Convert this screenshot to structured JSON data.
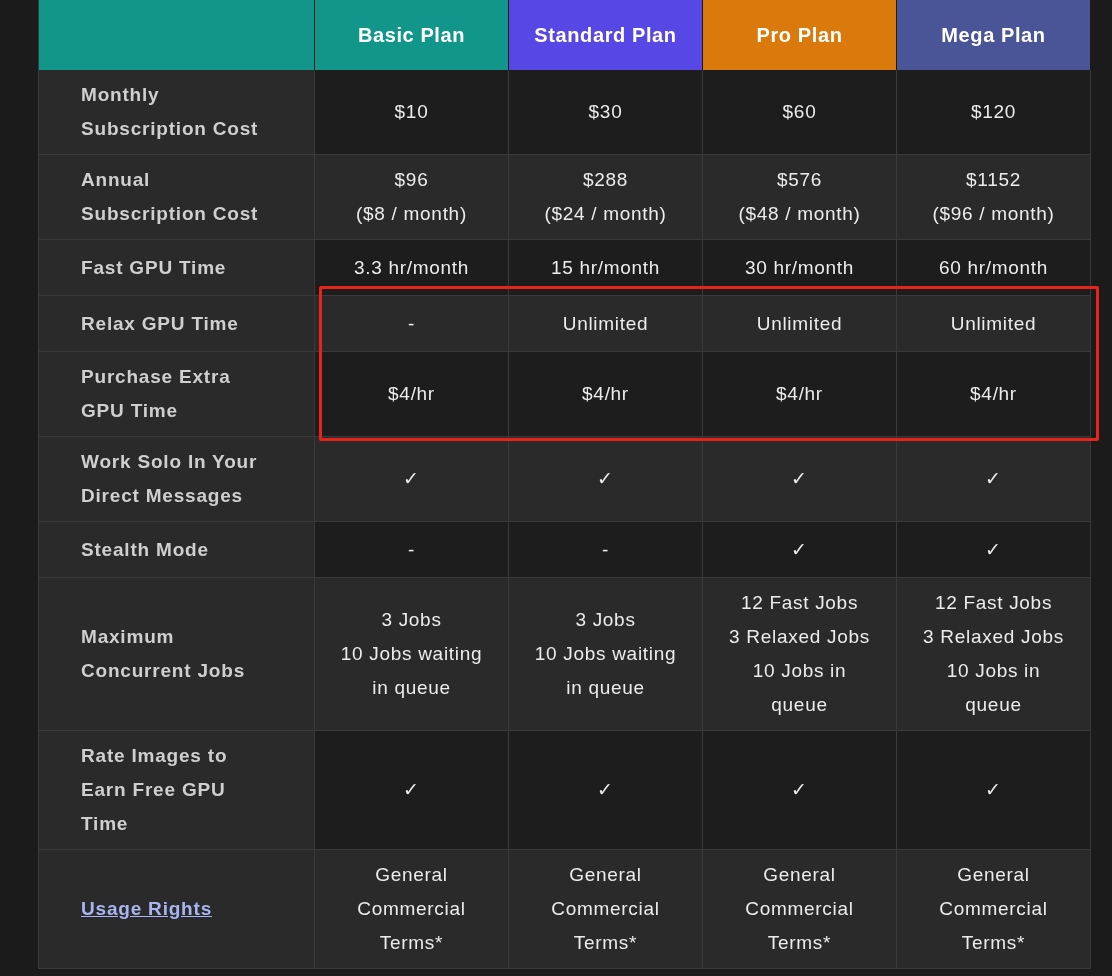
{
  "plans": [
    {
      "name": "Basic Plan",
      "color": "#12968a"
    },
    {
      "name": "Standard Plan",
      "color": "#5747e4"
    },
    {
      "name": "Pro Plan",
      "color": "#db7a0c"
    },
    {
      "name": "Mega Plan",
      "color": "#4a5597"
    }
  ],
  "rows": [
    {
      "label": "Monthly\nSubscription Cost",
      "kind": "text",
      "highlighted": false,
      "values": [
        "$10",
        "$30",
        "$60",
        "$120"
      ]
    },
    {
      "label": "Annual\nSubscription Cost",
      "kind": "text",
      "highlighted": false,
      "values": [
        "$96\n($8 / month)",
        "$288\n($24 / month)",
        "$576\n($48 / month)",
        "$1152\n($96 / month)"
      ]
    },
    {
      "label": "Fast GPU Time",
      "kind": "text",
      "highlighted": false,
      "values": [
        "3.3 hr/month",
        "15 hr/month",
        "30 hr/month",
        "60 hr/month"
      ]
    },
    {
      "label": "Relax GPU Time",
      "kind": "text",
      "highlighted": true,
      "values": [
        "-",
        "Unlimited",
        "Unlimited",
        "Unlimited"
      ]
    },
    {
      "label": "Purchase Extra\nGPU Time",
      "kind": "text",
      "highlighted": true,
      "values": [
        "$4/hr",
        "$4/hr",
        "$4/hr",
        "$4/hr"
      ]
    },
    {
      "label": "Work Solo In Your\nDirect Messages",
      "kind": "text",
      "highlighted": false,
      "values": [
        "✓",
        "✓",
        "✓",
        "✓"
      ]
    },
    {
      "label": "Stealth Mode",
      "kind": "text",
      "highlighted": false,
      "values": [
        "-",
        "-",
        "✓",
        "✓"
      ]
    },
    {
      "label": "Maximum\nConcurrent Jobs",
      "kind": "text",
      "highlighted": false,
      "values": [
        "3 Jobs\n10 Jobs waiting\nin queue",
        "3 Jobs\n10 Jobs waiting\nin queue",
        "12 Fast Jobs\n3 Relaxed Jobs\n10 Jobs in\nqueue",
        "12 Fast Jobs\n3 Relaxed Jobs\n10 Jobs in\nqueue"
      ]
    },
    {
      "label": "Rate Images to\nEarn Free GPU\nTime",
      "kind": "text",
      "highlighted": false,
      "values": [
        "✓",
        "✓",
        "✓",
        "✓"
      ]
    },
    {
      "label": "Usage Rights",
      "kind": "link",
      "highlighted": false,
      "values": [
        "General\nCommercial\nTerms*",
        "General\nCommercial\nTerms*",
        "General\nCommercial\nTerms*",
        "General\nCommercial\nTerms*"
      ]
    }
  ]
}
